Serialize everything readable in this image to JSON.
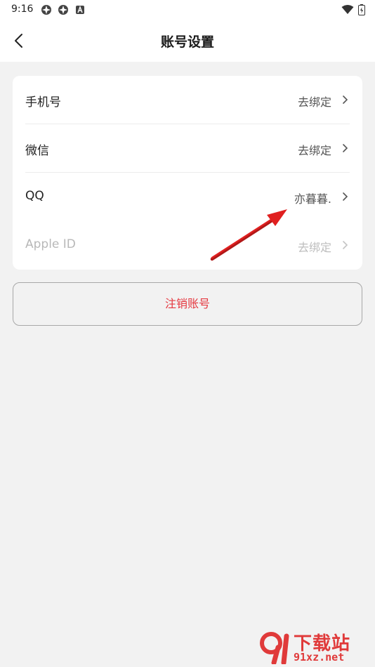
{
  "status_bar": {
    "time": "9:16",
    "left_icons": [
      "app-icon",
      "app-icon",
      "a-icon"
    ],
    "right_icons": [
      "wifi-icon",
      "battery-icon"
    ]
  },
  "nav": {
    "back_icon": "chevron-left-icon",
    "title": "账号设置"
  },
  "accounts": {
    "phone": {
      "label": "手机号",
      "value": "去绑定"
    },
    "wechat": {
      "label": "微信",
      "value": "去绑定"
    },
    "qq": {
      "label": "QQ",
      "value": "亦暮暮."
    },
    "apple": {
      "label": "Apple ID",
      "value": "去绑定"
    }
  },
  "logout": {
    "label": "注销账号"
  },
  "watermark": {
    "brand": "下载站",
    "domain": "91xz.net"
  },
  "colors": {
    "background": "#f2f2f2",
    "danger": "#e5373f",
    "annotation": "#e02020"
  }
}
